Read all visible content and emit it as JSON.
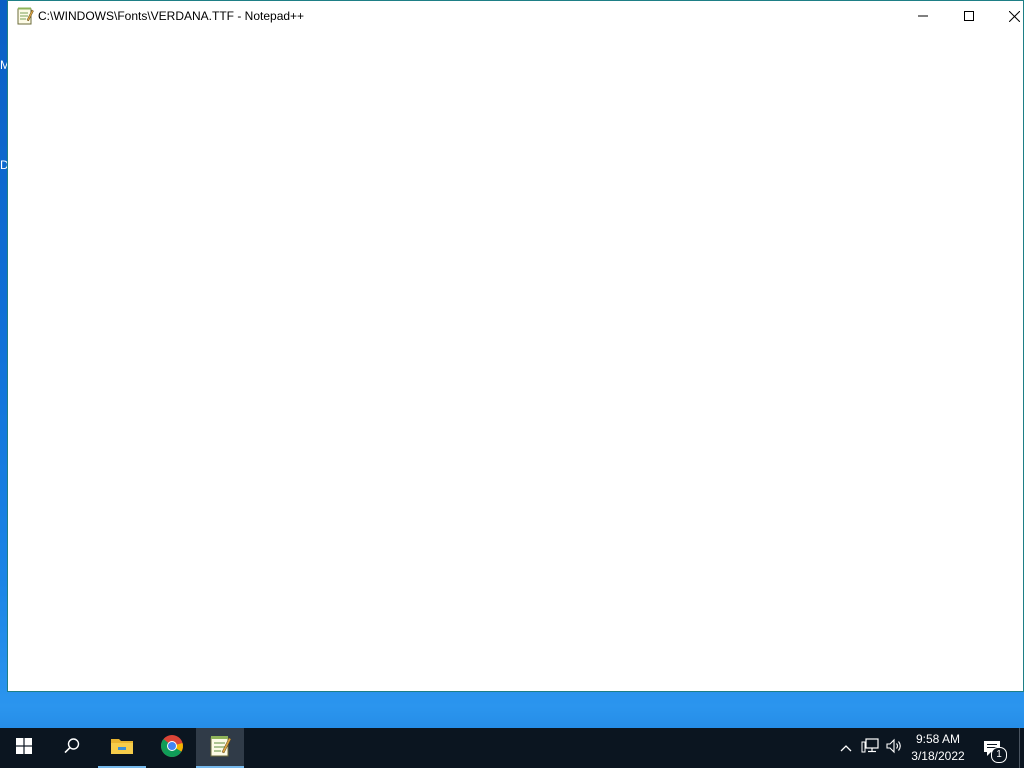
{
  "desktop": {
    "peek_letters": [
      "M",
      "D"
    ]
  },
  "window": {
    "title": "C:\\WINDOWS\\Fonts\\VERDANA.TTF - Notepad++",
    "app_icon": "notepadpp-icon",
    "controls": {
      "minimize_icon": "minimize-icon",
      "maximize_icon": "maximize-icon",
      "close_icon": "close-icon"
    }
  },
  "taskbar": {
    "start_icon": "windows-start-icon",
    "search_icon": "search-icon",
    "apps": [
      {
        "name": "File Explorer",
        "icon": "file-explorer-icon",
        "active": false
      },
      {
        "name": "Google Chrome",
        "icon": "chrome-icon",
        "active": false
      },
      {
        "name": "Notepad++",
        "icon": "notepadpp-icon",
        "active": true
      }
    ],
    "tray": {
      "chevron_icon": "chevron-up-icon",
      "network_icon": "network-icon",
      "volume_icon": "volume-icon"
    },
    "clock": {
      "time": "9:58 AM",
      "date": "3/18/2022"
    },
    "notifications": {
      "icon": "action-center-icon",
      "count": "1"
    }
  },
  "colors": {
    "taskbar_bg": "#0b1520",
    "active_indicator": "#76b9ed",
    "window_border": "#1e7f86",
    "desktop_blue": "#0f6fd6"
  }
}
